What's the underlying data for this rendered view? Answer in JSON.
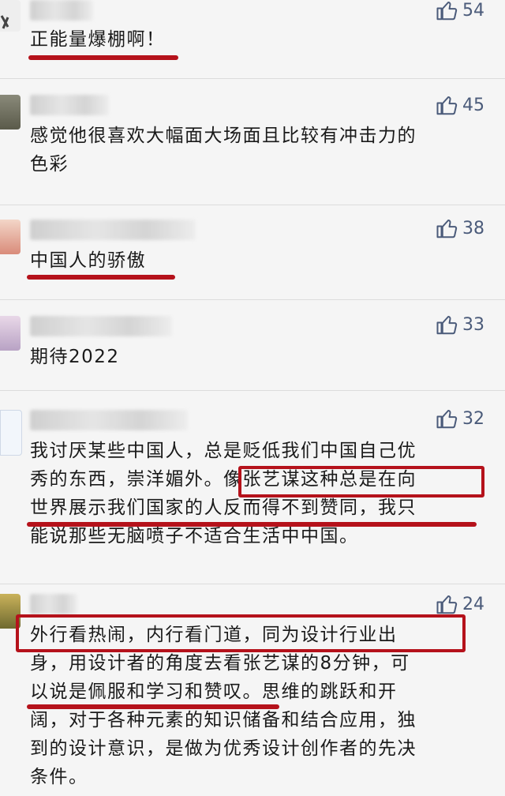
{
  "comments": [
    {
      "likes": "54",
      "text": "正能量爆棚啊！"
    },
    {
      "likes": "45",
      "text": "感觉他很喜欢大幅面大场面且比较有冲击力的\n色彩"
    },
    {
      "likes": "38",
      "text": "中国人的骄傲"
    },
    {
      "likes": "33",
      "text": "期待2022"
    },
    {
      "likes": "32",
      "text": "我讨厌某些中国人，总是贬低我们中国自己优\n秀的东西，崇洋媚外。像张艺谋这种总是在向\n世界展示我们国家的人反而得不到赞同，我只\n能说那些无脑喷子不适合生活中中国。"
    },
    {
      "likes": "24",
      "text": "外行看热闹，内行看门道，同为设计行业出\n身，用设计者的角度去看张艺谋的8分钟，可\n以说是佩服和学习和赞叹。思维的跳跃和开\n阔，对于各种元素的知识储备和结合应用，独\n到的设计意识，是做为优秀设计创作者的先决\n条件。"
    }
  ],
  "icons": {
    "like": "thumbs-up-icon"
  },
  "colors": {
    "highlight": "#b5121b",
    "like": "#4b5b7a"
  }
}
